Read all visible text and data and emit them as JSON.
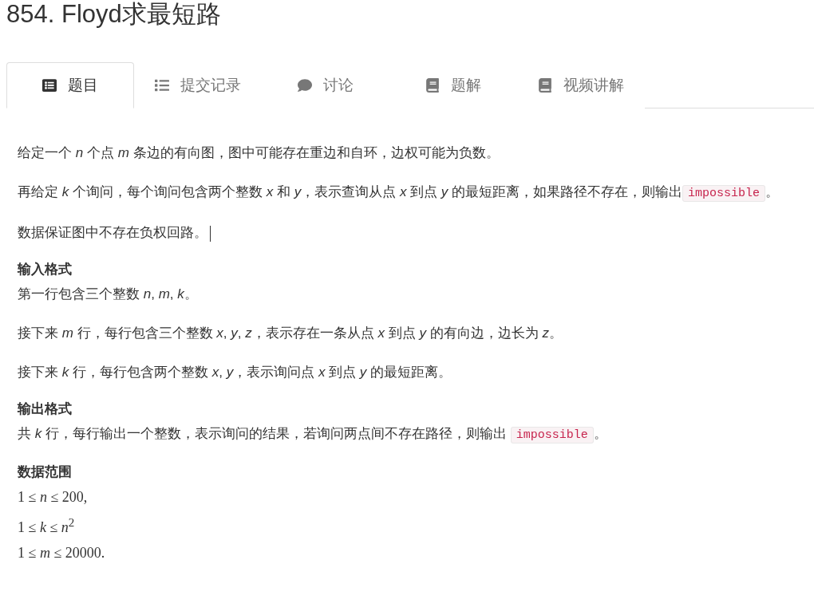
{
  "title": "854. Floyd求最短路",
  "tabs": [
    {
      "label": "题目",
      "selected": true
    },
    {
      "label": "提交记录",
      "selected": false
    },
    {
      "label": "讨论",
      "selected": false
    },
    {
      "label": "题解",
      "selected": false
    },
    {
      "label": "视频讲解",
      "selected": false
    }
  ],
  "sections": [
    {
      "kind": "body",
      "paragraphs": [
        [
          {
            "kind": "text",
            "text": "给定一个 *n* 个点 *m* 条边的有向图，图中可能存在重边和自环，边权可能为负数。"
          }
        ],
        [
          {
            "kind": "text",
            "text": "再给定 *k* 个询问，每个询问包含两个整数 *x* 和 *y*，表示查询从点 *x* 到点 *y* 的最短距离，如果路径不存在，则输出"
          },
          {
            "kind": "code",
            "text": "impossible"
          },
          {
            "kind": "text",
            "text": "。"
          }
        ],
        [
          {
            "kind": "text",
            "text": "数据保证图中不存在负权回路。"
          },
          {
            "kind": "cursor"
          }
        ]
      ]
    },
    {
      "kind": "section",
      "heading": "输入格式",
      "paragraphs": [
        [
          {
            "kind": "text",
            "text": "第一行包含三个整数 *n*, *m*, *k*。"
          }
        ],
        [
          {
            "kind": "text",
            "text": "接下来 *m* 行，每行包含三个整数 *x*, *y*, *z*，表示存在一条从点 *x* 到点 *y* 的有向边，边长为 *z*。"
          }
        ],
        [
          {
            "kind": "text",
            "text": "接下来 *k* 行，每行包含两个整数 *x*, *y*，表示询问点 *x* 到点 *y* 的最短距离。"
          }
        ]
      ]
    },
    {
      "kind": "section",
      "heading": "输出格式",
      "paragraphs": [
        [
          {
            "kind": "text",
            "text": "共 *k* 行，每行输出一个整数，表示询问的结果，若询问两点间不存在路径，则输出 "
          },
          {
            "kind": "code",
            "text": "impossible"
          },
          {
            "kind": "text",
            "text": "。"
          }
        ]
      ]
    },
    {
      "kind": "section",
      "heading": "数据范围",
      "formulas": [
        "1 ≤ *n* ≤ 200,",
        "1 ≤ *k* ≤ *n*$^{2}$",
        "1 ≤ *m* ≤ 20000."
      ]
    }
  ]
}
